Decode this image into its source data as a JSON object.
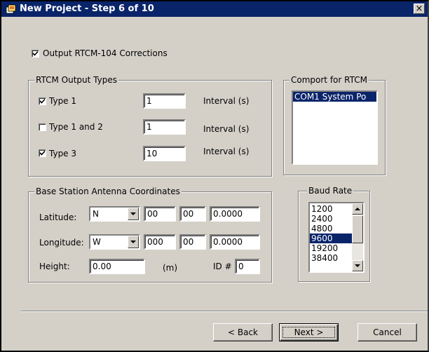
{
  "window": {
    "title": "New Project - Step 6 of 10",
    "close_glyph": "×"
  },
  "output_checkbox": {
    "label": "Output RTCM-104 Corrections",
    "checked": true
  },
  "rtcm_types": {
    "legend": "RTCM Output Types",
    "rows": [
      {
        "label": "Type 1",
        "checked": true,
        "value": "1",
        "unit": "Interval (s)"
      },
      {
        "label": "Type 1 and 2",
        "checked": false,
        "value": "1",
        "unit": "Interval (s)"
      },
      {
        "label": "Type 3",
        "checked": true,
        "value": "10",
        "unit": "Interval (s)"
      }
    ]
  },
  "comport": {
    "legend": "Comport for RTCM",
    "items": [
      "COM1  System Po"
    ]
  },
  "antenna": {
    "legend": "Base Station Antenna Coordinates",
    "latitude": {
      "label": "Latitude:",
      "hemisphere": "N",
      "deg": "00",
      "min": "00",
      "sec": "0.0000"
    },
    "longitude": {
      "label": "Longitude:",
      "hemisphere": "W",
      "deg": "000",
      "min": "00",
      "sec": "0.0000"
    },
    "height": {
      "label": "Height:",
      "value": "0.00",
      "unit": "(m)"
    },
    "id": {
      "label": "ID #",
      "value": "0"
    }
  },
  "baud": {
    "legend": "Baud Rate",
    "options": [
      "1200",
      "2400",
      "4800",
      "9600",
      "19200",
      "38400"
    ],
    "selected": "9600"
  },
  "buttons": {
    "back": "< Back",
    "next": "Next >",
    "cancel": "Cancel"
  },
  "icons": {
    "app": "project-wizard-icon",
    "close": "close-icon",
    "dropdown": "chevron-down-icon",
    "check": "checkmark-icon"
  },
  "colors": {
    "titlebar": "#0a246a",
    "face": "#d4d0c8",
    "selection": "#0a246a"
  }
}
